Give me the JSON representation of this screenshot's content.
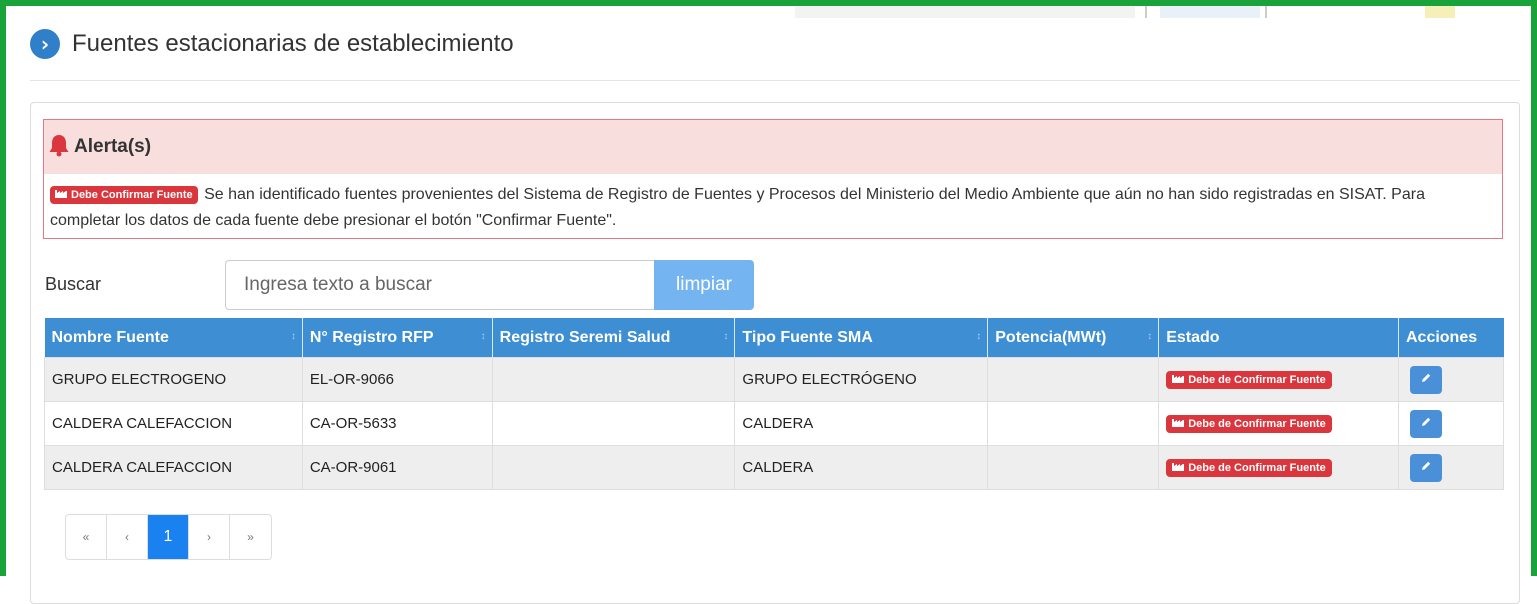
{
  "page": {
    "title": "Fuentes estacionarias de establecimiento"
  },
  "alert": {
    "title": "Alerta(s)",
    "label": "Debe Confirmar Fuente",
    "message": "Se han identificado fuentes provenientes del Sistema de Registro de Fuentes y Procesos del Ministerio del Medio Ambiente que aún no han sido registradas en SISAT. Para completar los datos de cada fuente debe presionar el botón \"Confirmar Fuente\"."
  },
  "search": {
    "label": "Buscar",
    "placeholder": "Ingresa texto a buscar",
    "clear_label": "limpiar"
  },
  "table": {
    "columns": [
      "Nombre Fuente",
      "N° Registro RFP",
      "Registro Seremi Salud",
      "Tipo Fuente SMA",
      "Potencia(MWt)",
      "Estado",
      "Acciones"
    ],
    "rows": [
      {
        "nombre": "GRUPO ELECTROGENO",
        "registro_rfp": "EL-OR-9066",
        "seremi": "",
        "tipo": "GRUPO ELECTRÓGENO",
        "potencia": "",
        "estado": "Debe de Confirmar Fuente"
      },
      {
        "nombre": "CALDERA CALEFACCION",
        "registro_rfp": "CA-OR-5633",
        "seremi": "",
        "tipo": "CALDERA",
        "potencia": "",
        "estado": "Debe de Confirmar Fuente"
      },
      {
        "nombre": "CALDERA CALEFACCION",
        "registro_rfp": "CA-OR-9061",
        "seremi": "",
        "tipo": "CALDERA",
        "potencia": "",
        "estado": "Debe de Confirmar Fuente"
      }
    ]
  },
  "pagination": {
    "first": "«",
    "prev": "‹",
    "current": "1",
    "next": "›",
    "last": "»"
  },
  "colors": {
    "frame": "#1aa33a",
    "header_blue": "#3e8ed4",
    "danger": "#d9363e",
    "alert_bg": "#f9dede"
  }
}
